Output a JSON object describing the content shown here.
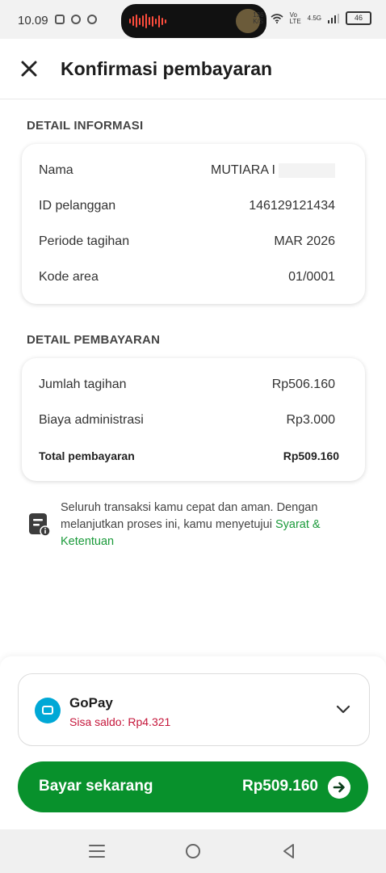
{
  "statusbar": {
    "time": "10.09",
    "net_speed": "136\nK/S",
    "volte": "Vo\nLTE",
    "signal": "4.5G",
    "battery": "46"
  },
  "header": {
    "title": "Konfirmasi pembayaran"
  },
  "info_section": {
    "title": "DETAIL INFORMASI",
    "rows": [
      {
        "label": "Nama",
        "value": "MUTIARA I"
      },
      {
        "label": "ID pelanggan",
        "value": "146129121434"
      },
      {
        "label": "Periode tagihan",
        "value": "MAR 2026"
      },
      {
        "label": "Kode area",
        "value": "01/0001"
      }
    ]
  },
  "payment_section": {
    "title": "DETAIL PEMBAYARAN",
    "rows": [
      {
        "label": "Jumlah tagihan",
        "value": "Rp506.160"
      },
      {
        "label": "Biaya administrasi",
        "value": "Rp3.000"
      },
      {
        "label": "Total pembayaran",
        "value": "Rp509.160"
      }
    ]
  },
  "notice": {
    "text": "Seluruh transaksi kamu cepat dan aman. Dengan melanjutkan proses ini, kamu menyetujui ",
    "link": "Syarat & Ketentuan"
  },
  "payment_method": {
    "name": "GoPay",
    "balance": "Sisa saldo: Rp4.321"
  },
  "pay_button": {
    "label": "Bayar sekarang",
    "amount": "Rp509.160"
  },
  "colors": {
    "accent_green": "#08912c",
    "link_green": "#1a9a3a",
    "balance_red": "#c5173b",
    "gopay_blue": "#00a8d6"
  }
}
